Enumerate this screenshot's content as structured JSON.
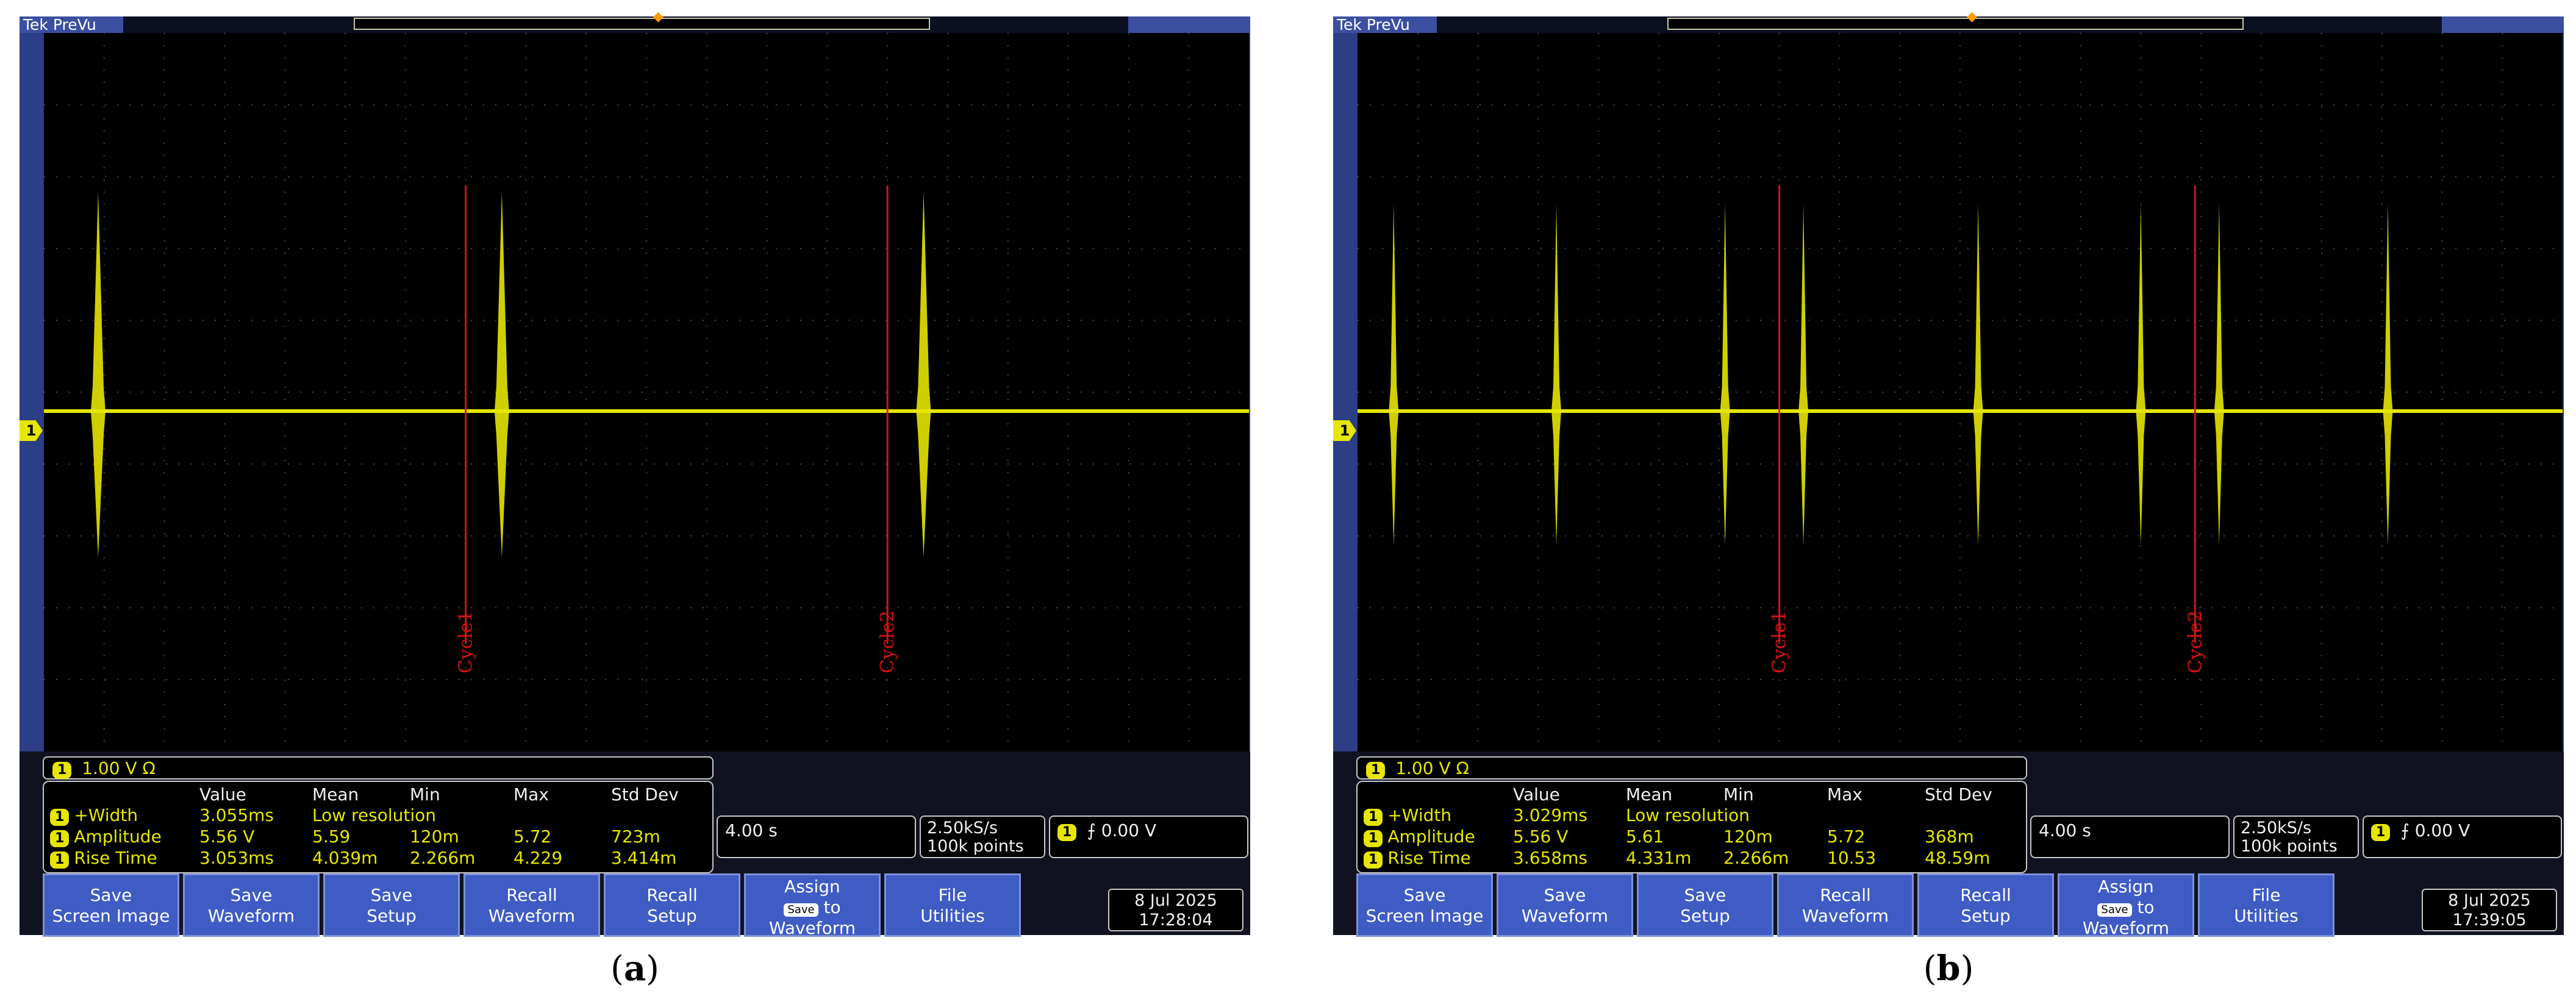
{
  "colors": {
    "trace": "#e6e600",
    "cycle_marker": "#d41313",
    "softkey": "#3f5cc4"
  },
  "panels": [
    {
      "caption_label": "a",
      "brand": "Tek",
      "mode": "PreVu",
      "scale": {
        "channel": "1",
        "volts_per_div": "1.00 V",
        "impedance": "Ω"
      },
      "measurements": {
        "headers": [
          "Value",
          "Mean",
          "Min",
          "Max",
          "Std Dev"
        ],
        "rows": [
          {
            "name": "+Width",
            "value": "3.055ms",
            "mean": "Low resolution",
            "min": "",
            "max": "",
            "std_dev": ""
          },
          {
            "name": "Amplitude",
            "value": "5.56 V",
            "mean": "5.59",
            "min": "120m",
            "max": "5.72",
            "std_dev": "723m"
          },
          {
            "name": "Rise Time",
            "value": "3.053ms",
            "mean": "4.039m",
            "min": "2.266m",
            "max": "4.229",
            "std_dev": "3.414m"
          }
        ]
      },
      "timebase": "4.00 s",
      "sample_rate": "2.50kS/s",
      "record_length": "100k points",
      "trigger": {
        "channel": "1",
        "slope_icon": "rising-edge-icon",
        "level": "0.00 V"
      },
      "date": "8 Jul  2025",
      "time": "17:28:04",
      "cycle_labels": [
        "Cycle1",
        "Cycle2"
      ],
      "bursts_time_divisions": [
        0.9,
        7.6,
        14.6
      ],
      "cycle_markers_time_divisions": [
        7.0,
        14.0
      ]
    },
    {
      "caption_label": "b",
      "brand": "Tek",
      "mode": "PreVu",
      "scale": {
        "channel": "1",
        "volts_per_div": "1.00 V",
        "impedance": "Ω"
      },
      "measurements": {
        "headers": [
          "Value",
          "Mean",
          "Min",
          "Max",
          "Std Dev"
        ],
        "rows": [
          {
            "name": "+Width",
            "value": "3.029ms",
            "mean": "Low resolution",
            "min": "",
            "max": "",
            "std_dev": ""
          },
          {
            "name": "Amplitude",
            "value": "5.56 V",
            "mean": "5.61",
            "min": "120m",
            "max": "5.72",
            "std_dev": "368m"
          },
          {
            "name": "Rise Time",
            "value": "3.658ms",
            "mean": "4.331m",
            "min": "2.266m",
            "max": "10.53",
            "std_dev": "48.59m"
          }
        ]
      },
      "timebase": "4.00 s",
      "sample_rate": "2.50kS/s",
      "record_length": "100k points",
      "trigger": {
        "channel": "1",
        "slope_icon": "rising-edge-icon",
        "level": "0.00 V"
      },
      "date": "8 Jul  2025",
      "time": "17:39:05",
      "cycle_labels": [
        "Cycle1",
        "Cycle2"
      ],
      "bursts_time_divisions": [
        0.6,
        3.3,
        6.1,
        7.4,
        10.3,
        13.0,
        14.3,
        17.1
      ],
      "cycle_markers_time_divisions": [
        7.0,
        13.9
      ]
    }
  ],
  "softkeys": [
    {
      "line1": "Save",
      "line2": "Screen Image"
    },
    {
      "line1": "Save",
      "line2": "Waveform"
    },
    {
      "line1": "Save",
      "line2": "Setup"
    },
    {
      "line1": "Recall",
      "line2": "Waveform"
    },
    {
      "line1": "Recall",
      "line2": "Setup"
    },
    {
      "line1": "Assign",
      "chip": "Save",
      "mid": "to",
      "line2": "Waveform"
    },
    {
      "line1": "File",
      "line2": "Utilities"
    }
  ]
}
